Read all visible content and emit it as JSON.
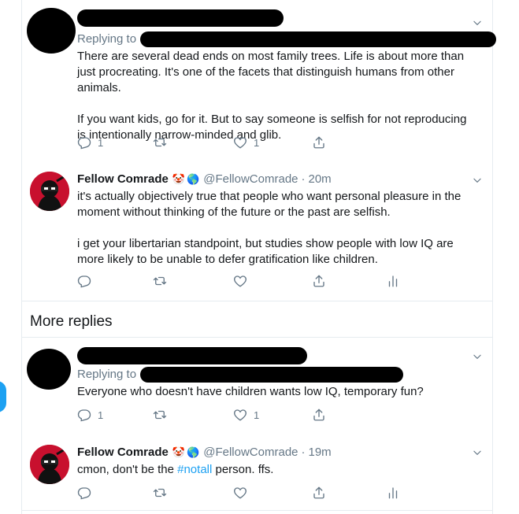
{
  "tweets": [
    {
      "replying_to": "Replying to",
      "text": [
        "There are several dead ends on most family trees. Life is about more than just procreating. It's one of the facets that distinguish humans from other animals.",
        "If you want kids, go for it. But to say someone is selfish for not reproducing is intentionally narrow-minded and glib."
      ],
      "reply_count": "1",
      "like_count": "1"
    },
    {
      "name": "Fellow Comrade",
      "emojis": [
        "🤡",
        "🌎"
      ],
      "handle": "@FellowComrade",
      "dot": "·",
      "time": "20m",
      "text": [
        "it's actually objectively true that people who want personal pleasure in the moment without thinking of the future or the past are selfish.",
        "i get your libertarian standpoint, but studies show people with low IQ are more likely to be unable to defer gratification like children."
      ]
    },
    {
      "replying_to": "Replying to",
      "text": [
        "Everyone who doesn't have children wants low IQ, temporary fun?"
      ],
      "reply_count": "1",
      "like_count": "1"
    },
    {
      "name": "Fellow Comrade",
      "emojis": [
        "🤡",
        "🌎"
      ],
      "handle": "@FellowComrade",
      "dot": "·",
      "time": "19m",
      "text_before": "cmon, don't be the ",
      "hashtag": "#notall",
      "text_after": " person. ffs."
    }
  ],
  "more_replies": "More replies",
  "icons": {
    "reply": "reply-icon",
    "retweet": "retweet-icon",
    "like": "heart-icon",
    "share": "share-icon",
    "analytics": "analytics-icon",
    "caret": "chevron-down-icon"
  },
  "colors": {
    "accent": "#1da1f2",
    "secondary_text": "#657786",
    "divider": "#e6ecf0"
  }
}
